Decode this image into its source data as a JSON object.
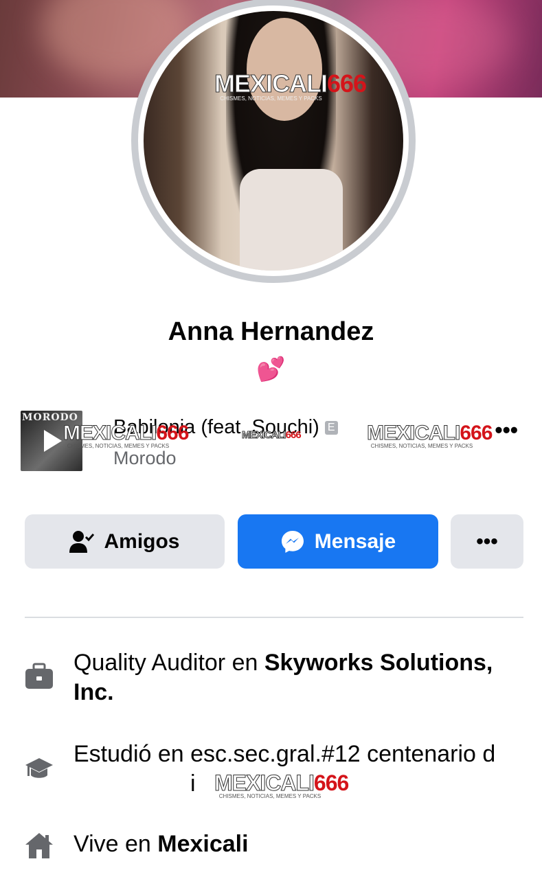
{
  "profile": {
    "name": "Anna Hernandez",
    "bio_emoji": "💕"
  },
  "watermark": {
    "main": "MEXICALI",
    "number": "666",
    "tagline": "CHISMES, NOTICIAS, MEMES Y PACKS"
  },
  "music": {
    "album_text": "MORODO",
    "song_title": "Babilonia (feat. Souchi)",
    "explicit_badge": "E",
    "artist": "Morodo",
    "more_label": "•••"
  },
  "actions": {
    "friends_label": "Amigos",
    "message_label": "Mensaje",
    "more_label": "•••"
  },
  "details": {
    "work_prefix": "Quality Auditor en ",
    "work_company": "Skyworks Solutions, Inc.",
    "study_text": "Estudió en esc.sec.gral.#12 centenario d",
    "study_tail": "i",
    "home_prefix": "Vive en ",
    "home_city": "Mexicali"
  },
  "colors": {
    "primary_blue": "#1877f2",
    "secondary_button": "#e4e6eb",
    "icon_gray": "#65676b",
    "divider": "#dadde1"
  },
  "icons": {
    "friends": "person-check-icon",
    "messenger": "messenger-icon",
    "work": "briefcase-icon",
    "study": "graduation-cap-icon",
    "home": "house-icon"
  }
}
